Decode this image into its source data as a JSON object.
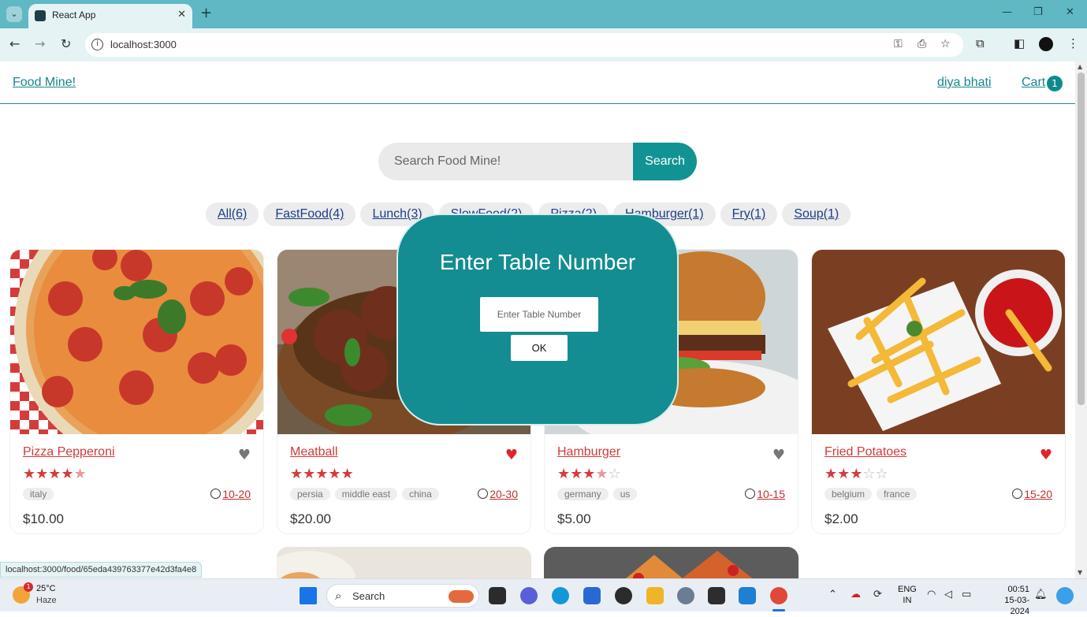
{
  "browser": {
    "tab_title": "React App",
    "url": "localhost:3000",
    "status_url": "localhost:3000/food/65eda439763377e42d3fa4e8"
  },
  "header": {
    "brand": "Food Mine!",
    "user": "diya bhati",
    "cart_label": "Cart",
    "cart_count": "1"
  },
  "search": {
    "placeholder": "Search Food Mine!",
    "button": "Search"
  },
  "tags": [
    "All(6)",
    "FastFood(4)",
    "Lunch(3)",
    "SlowFood(2)",
    "Pizza(2)",
    "Hamburger(1)",
    "Fry(1)",
    "Soup(1)"
  ],
  "foods": [
    {
      "name": "Pizza Pepperoni",
      "favorite": false,
      "stars": 4.5,
      "origins": [
        "italy"
      ],
      "cook_time": "10-20",
      "price": "$10.00"
    },
    {
      "name": "Meatball",
      "favorite": true,
      "stars": 5,
      "origins": [
        "persia",
        "middle east",
        "china"
      ],
      "cook_time": "20-30",
      "price": "$20.00"
    },
    {
      "name": "Hamburger",
      "favorite": false,
      "stars": 3.5,
      "origins": [
        "germany",
        "us"
      ],
      "cook_time": "10-15",
      "price": "$5.00"
    },
    {
      "name": "Fried Potatoes",
      "favorite": true,
      "stars": 3,
      "origins": [
        "belgium",
        "france"
      ],
      "cook_time": "15-20",
      "price": "$2.00"
    }
  ],
  "modal": {
    "title": "Enter Table Number",
    "input_placeholder": "Enter Table Number",
    "ok": "OK"
  },
  "taskbar": {
    "weather_badge": "1",
    "temperature": "25°C",
    "weather": "Haze",
    "search": "Search",
    "lang_top": "ENG",
    "lang_bottom": "IN",
    "time": "00:51",
    "date": "15-03-2024"
  },
  "colors": {
    "brand": "#16868c",
    "accent": "#129393",
    "food_name": "#d23a3a",
    "tag_text": "#1c3c8a"
  }
}
